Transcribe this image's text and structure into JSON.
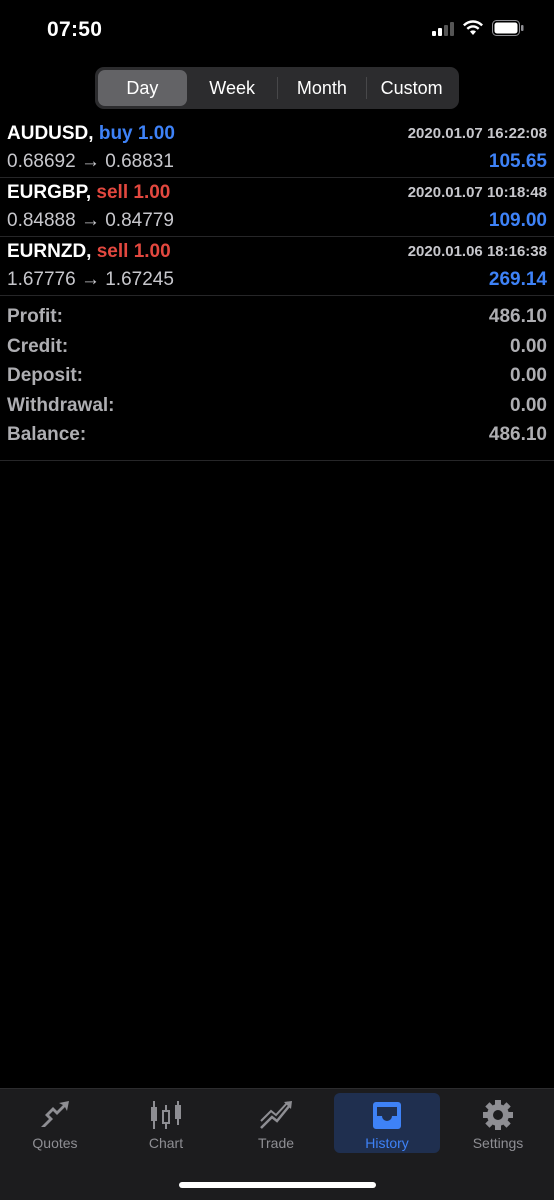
{
  "status": {
    "time": "07:50"
  },
  "segments": [
    {
      "label": "Day",
      "active": true
    },
    {
      "label": "Week",
      "active": false
    },
    {
      "label": "Month",
      "active": false
    },
    {
      "label": "Custom",
      "active": false
    }
  ],
  "trades": [
    {
      "symbol": "AUDUSD,",
      "side": "buy 1.00",
      "side_type": "buy",
      "time": "2020.01.07 16:22:08",
      "prices": "0.68692 → 0.68831",
      "profit": "105.65"
    },
    {
      "symbol": "EURGBP,",
      "side": "sell 1.00",
      "side_type": "sell",
      "time": "2020.01.07 10:18:48",
      "prices": "0.84888 → 0.84779",
      "profit": "109.00"
    },
    {
      "symbol": "EURNZD,",
      "side": "sell 1.00",
      "side_type": "sell",
      "time": "2020.01.06 18:16:38",
      "prices": "1.67776 → 1.67245",
      "profit": "269.14"
    }
  ],
  "summary": [
    {
      "label": "Profit:",
      "value": "486.10"
    },
    {
      "label": "Credit:",
      "value": "0.00"
    },
    {
      "label": "Deposit:",
      "value": "0.00"
    },
    {
      "label": "Withdrawal:",
      "value": "0.00"
    },
    {
      "label": "Balance:",
      "value": "486.10"
    }
  ],
  "tabs": [
    {
      "label": "Quotes",
      "icon": "quotes-icon",
      "active": false
    },
    {
      "label": "Chart",
      "icon": "candlestick-chart-icon",
      "active": false
    },
    {
      "label": "Trade",
      "icon": "trade-icon",
      "active": false
    },
    {
      "label": "History",
      "icon": "history-inbox-icon",
      "active": true
    },
    {
      "label": "Settings",
      "icon": "gear-icon",
      "active": false
    }
  ],
  "colors": {
    "buy": "#3e82f7",
    "sell": "#e2483f",
    "accent": "#3e82f7"
  }
}
